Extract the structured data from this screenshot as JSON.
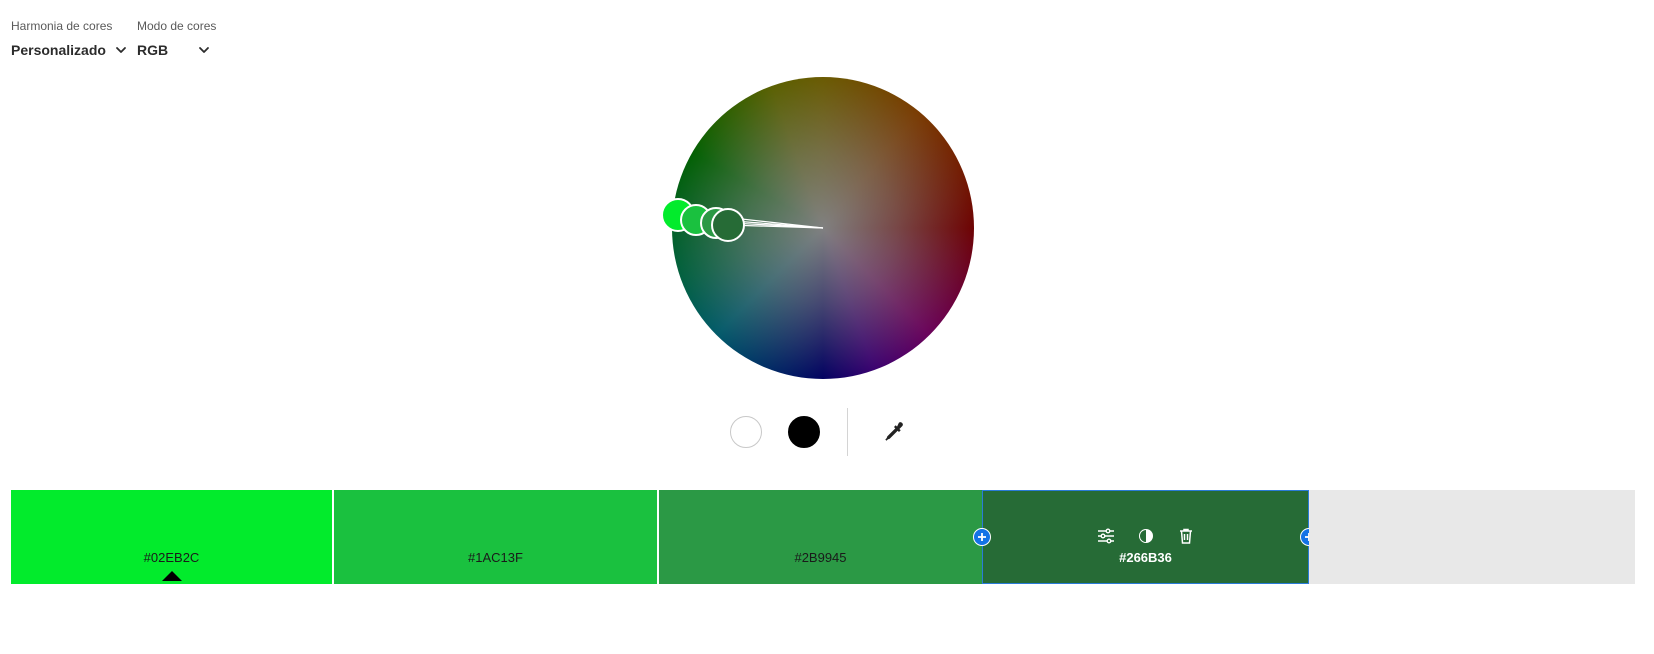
{
  "harmony": {
    "label": "Harmonia de cores",
    "value": "Personalizado"
  },
  "mode": {
    "label": "Modo de cores",
    "value": "RGB"
  },
  "icons": {
    "dropdown": "chevron-down-icon",
    "eyedropper": "eyedropper-icon",
    "adjust": "sliders-icon",
    "contrast": "contrast-icon",
    "delete": "trash-icon",
    "add": "plus-icon"
  },
  "quick_colors": {
    "white": "#FFFFFF",
    "black": "#000000"
  },
  "palette": {
    "swatches": [
      {
        "hex": "#02EB2C",
        "label": "#02EB2C",
        "base": true
      },
      {
        "hex": "#1AC13F",
        "label": "#1AC13F"
      },
      {
        "hex": "#2B9945",
        "label": "#2B9945"
      },
      {
        "hex": "#266B36",
        "label": "#266B36",
        "selected": true
      }
    ]
  },
  "accent_color": "#1473E6"
}
